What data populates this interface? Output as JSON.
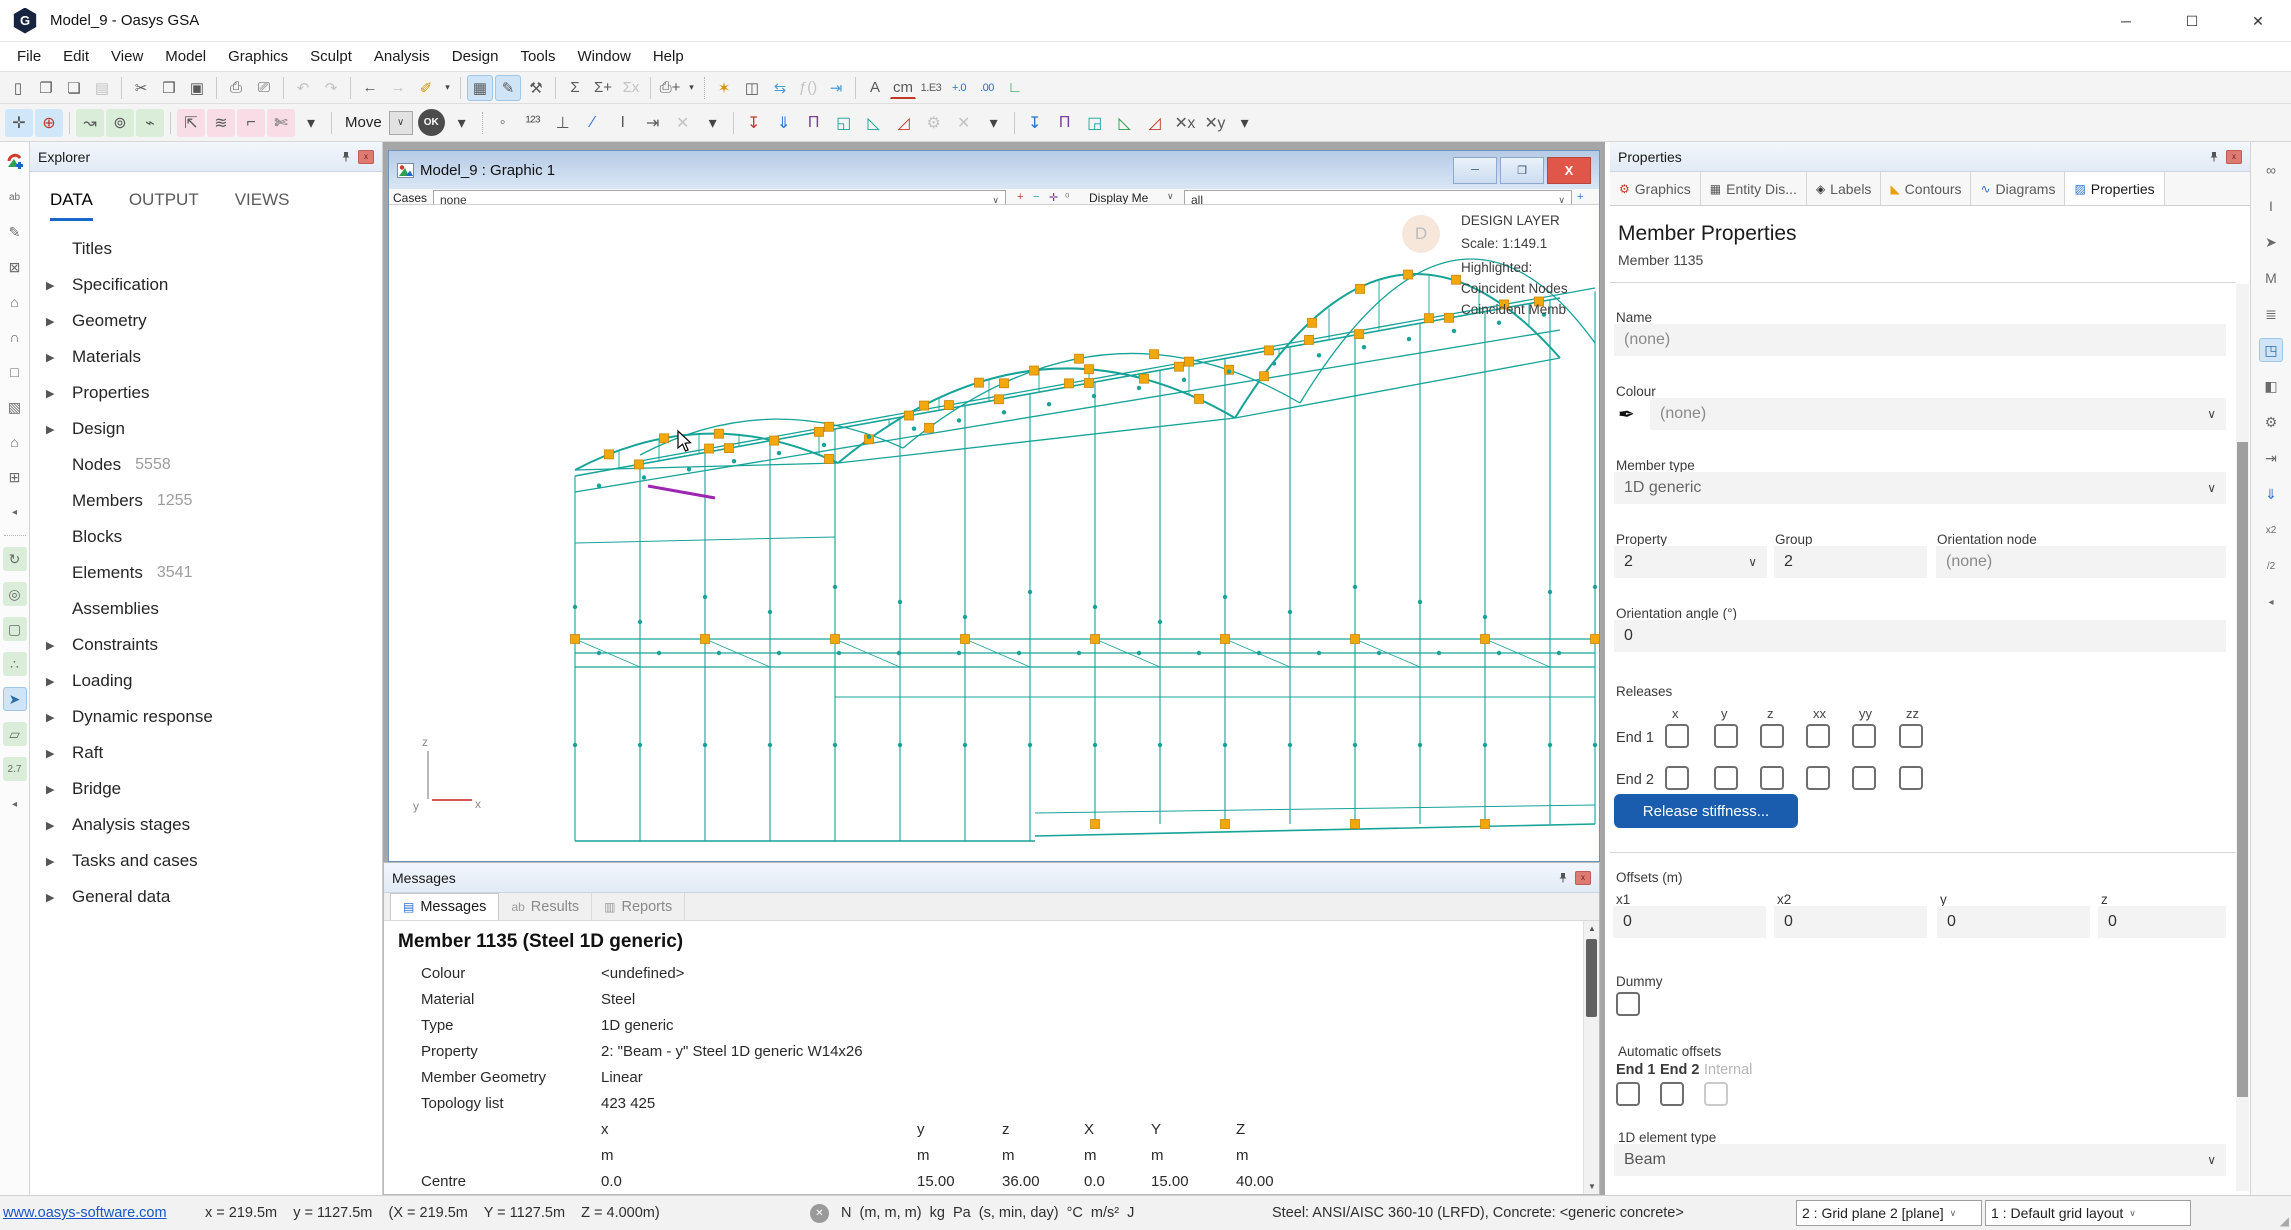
{
  "app": {
    "title": "Model_9 - Oasys GSA"
  },
  "menu": {
    "items": [
      "File",
      "Edit",
      "View",
      "Model",
      "Graphics",
      "Sculpt",
      "Analysis",
      "Design",
      "Tools",
      "Window",
      "Help"
    ]
  },
  "toolbar_labels": {
    "move": "Move",
    "ok": "OK"
  },
  "toolbar_main": [
    {
      "n": "new-file",
      "g": "▯"
    },
    {
      "n": "open-file",
      "g": "❐"
    },
    {
      "n": "open-recent",
      "g": "❏"
    },
    {
      "n": "save",
      "g": "▤",
      "d": 1
    },
    {
      "s": 1
    },
    {
      "n": "cut",
      "g": "✂"
    },
    {
      "n": "copy",
      "g": "❒"
    },
    {
      "n": "paste",
      "g": "▣"
    },
    {
      "s": 1
    },
    {
      "n": "print",
      "g": "⎙"
    },
    {
      "n": "print-preview",
      "g": "⎚"
    },
    {
      "s": 1
    },
    {
      "n": "undo",
      "g": "↶",
      "d": 1
    },
    {
      "n": "redo",
      "g": "↷",
      "d": 1
    },
    {
      "s": 1
    },
    {
      "n": "back",
      "g": "←"
    },
    {
      "n": "forward",
      "g": "→",
      "d": 1
    },
    {
      "n": "format-painter",
      "g": "✐",
      "c": "#d99000"
    },
    {
      "n": "format-painter-dropdown",
      "g": "▾",
      "dd": 1
    },
    {
      "s": 1
    },
    {
      "n": "table-view",
      "g": "▦",
      "a": 1
    },
    {
      "n": "sculpt-mode",
      "g": "✎",
      "a": 1
    },
    {
      "n": "tools-settings",
      "g": "⚒"
    },
    {
      "s": 1
    },
    {
      "n": "sum",
      "g": "Σ"
    },
    {
      "n": "sum-add",
      "g": "Σ+"
    },
    {
      "n": "sum-remove",
      "g": "Σx",
      "d": 1
    },
    {
      "s": 1
    },
    {
      "n": "print-view",
      "g": "⎙+"
    },
    {
      "n": "print-view-dropdown",
      "g": "▾",
      "dd": 1
    },
    {
      "ds": 1
    },
    {
      "n": "wizard",
      "g": "✶",
      "c": "#d99000"
    },
    {
      "n": "find",
      "g": "◫"
    },
    {
      "n": "sync-views",
      "g": "⇆",
      "c": "#4a9fd8"
    },
    {
      "n": "function",
      "g": "ƒ()",
      "d": 1
    },
    {
      "n": "wrap-lines",
      "g": "⇥",
      "c": "#4a9fd8"
    },
    {
      "s": 1
    },
    {
      "n": "font",
      "g": "A"
    },
    {
      "n": "units",
      "g": "cm",
      "u": 1
    },
    {
      "n": "numeric-format",
      "g": "1.E3",
      "sm": 1
    },
    {
      "n": "increase-decimals",
      "g": "+.0",
      "sm": 1,
      "c": "#2a6fd0"
    },
    {
      "n": "decrease-decimals",
      "g": ".00",
      "sm": 1,
      "c": "#2a6fd0"
    },
    {
      "n": "axes-display",
      "g": "∟",
      "c": "#2a9d4a"
    }
  ],
  "toolbar_sculpt": [
    {
      "n": "sculpt-drag",
      "g": "✛",
      "t": "blue"
    },
    {
      "n": "add-elements",
      "g": "⊕",
      "t": "blue",
      "c": "#c0392b"
    },
    {
      "s": 1
    },
    {
      "n": "modify-curve",
      "g": "↝",
      "t": "green"
    },
    {
      "n": "add-node",
      "g": "⊚",
      "t": "green"
    },
    {
      "n": "split-member",
      "g": "⌁",
      "t": "green"
    },
    {
      "s": 1
    },
    {
      "n": "move-axes",
      "g": "⇱",
      "t": "pink"
    },
    {
      "n": "flip-elements",
      "g": "≋",
      "t": "pink"
    },
    {
      "n": "offset-members",
      "g": "⌐",
      "t": "pink"
    },
    {
      "n": "trim-members",
      "g": "✄",
      "t": "pink"
    },
    {
      "n": "sculpt-dropdown",
      "g": "▾",
      "dd": 1
    },
    {
      "s": 1
    },
    {
      "type": "label",
      "n": "move-mode-label"
    },
    {
      "type": "sel",
      "n": "move-mode-select"
    },
    {
      "type": "ok",
      "n": "ok-button"
    },
    {
      "n": "ok-dropdown",
      "g": "▾",
      "dd": 1
    },
    {
      "ds": 1
    },
    {
      "n": "label-nodes",
      "g": "◦"
    },
    {
      "n": "label-node-numbers",
      "g": "¹²³",
      "sm": 1
    },
    {
      "n": "label-supports",
      "g": "⊥"
    },
    {
      "n": "label-member-numbers",
      "g": "∕",
      "c": "#2a6fd0"
    },
    {
      "n": "label-sections",
      "g": "I"
    },
    {
      "n": "label-align",
      "g": "⇥"
    },
    {
      "n": "labels-off",
      "g": "✕",
      "d": 1
    },
    {
      "n": "labels-dropdown",
      "g": "▾",
      "dd": 1
    },
    {
      "s": 1
    },
    {
      "n": "diagram-node-load",
      "g": "↧",
      "c": "#c0392b"
    },
    {
      "n": "diagram-beam-load",
      "g": "⇓",
      "c": "#2a6fd0"
    },
    {
      "n": "diagram-udl",
      "g": "Π",
      "c": "#7b3fa0"
    },
    {
      "n": "diagram-patch",
      "g": "◱",
      "c": "#17a398"
    },
    {
      "n": "diagram-shear",
      "g": "◺",
      "c": "#17a398"
    },
    {
      "n": "diagram-moment",
      "g": "◿",
      "c": "#c0392b"
    },
    {
      "n": "diagram-settings",
      "g": "⚙",
      "d": 1
    },
    {
      "n": "diagram-off",
      "g": "✕",
      "d": 1
    },
    {
      "n": "diagram-dropdown",
      "g": "▾",
      "dd": 1
    },
    {
      "s": 1
    },
    {
      "n": "contour-node-load",
      "g": "↧",
      "c": "#2a6fd0"
    },
    {
      "n": "contour-udl",
      "g": "Π",
      "c": "#7b3fa0"
    },
    {
      "n": "contour-patch",
      "g": "◲",
      "c": "#17a398"
    },
    {
      "n": "contour-shear",
      "g": "◺",
      "c": "#2a9d4a"
    },
    {
      "n": "contour-moment",
      "g": "◿",
      "c": "#c0392b"
    },
    {
      "n": "contour-x",
      "g": "✕x",
      "sm": 1
    },
    {
      "n": "contour-y",
      "g": "✕y",
      "sm": 1
    },
    {
      "n": "contour-dropdown",
      "g": "▾",
      "dd": 1
    }
  ],
  "left_strip": [
    {
      "n": "gsa-model",
      "logo": 1
    },
    {
      "n": "add-text",
      "g": "ab",
      "sm": 1
    },
    {
      "n": "sculpt-pencil",
      "g": "✎"
    },
    {
      "n": "section-view",
      "g": "⊠"
    },
    {
      "n": "structure-front",
      "g": "⌂"
    },
    {
      "n": "structure-side",
      "g": "∩"
    },
    {
      "n": "wireframe-box",
      "g": "□"
    },
    {
      "n": "solid-box",
      "g": "▧"
    },
    {
      "n": "building-view",
      "g": "⌂"
    },
    {
      "n": "expand-grid",
      "g": "⊞"
    },
    {
      "n": "collapse-left",
      "g": "◂",
      "sm": 1
    },
    {
      "ds": 1
    },
    {
      "n": "rotate-view",
      "g": "↻",
      "t": "green"
    },
    {
      "n": "zoom-view",
      "g": "◎",
      "t": "green"
    },
    {
      "n": "volume-view",
      "g": "▢",
      "t": "green"
    },
    {
      "n": "select-nodes",
      "g": "∴",
      "t": "green"
    },
    {
      "n": "select-members",
      "g": "➤",
      "a": 1
    },
    {
      "n": "polygon-select",
      "g": "▱",
      "t": "green"
    },
    {
      "n": "coordinate-entry",
      "g": "2.7",
      "t": "green",
      "sm": 1
    },
    {
      "n": "collapse-left-2",
      "g": "◂",
      "sm": 1
    }
  ],
  "right_strip": [
    {
      "n": "node-connection",
      "g": "∞"
    },
    {
      "n": "section-profile",
      "g": "I"
    },
    {
      "n": "pointer-settings",
      "g": "➤"
    },
    {
      "n": "polyline-tool",
      "g": "M"
    },
    {
      "n": "animation-strip",
      "g": "≣"
    },
    {
      "n": "volume-clip",
      "g": "◳",
      "a": 1
    },
    {
      "n": "contour-display-settings",
      "g": "◧"
    },
    {
      "n": "graphic-settings",
      "g": "⚙"
    },
    {
      "n": "shrink-elements",
      "g": "⇥"
    },
    {
      "n": "diagram-scale",
      "g": "⇓",
      "c": "#2a6fd0"
    },
    {
      "n": "scale-x2",
      "g": "x2",
      "sm": 1
    },
    {
      "n": "scale-half",
      "g": "/2",
      "sm": 1
    },
    {
      "n": "collapse-right",
      "g": "◂",
      "sm": 1
    }
  ],
  "explorer": {
    "title": "Explorer",
    "tabs": [
      {
        "label": "DATA",
        "active": true
      },
      {
        "label": "OUTPUT",
        "active": false
      },
      {
        "label": "VIEWS",
        "active": false
      }
    ],
    "tree": [
      {
        "label": "Titles"
      },
      {
        "label": "Specification",
        "expandable": true
      },
      {
        "label": "Geometry",
        "expandable": true
      },
      {
        "label": "Materials",
        "expandable": true
      },
      {
        "label": "Properties",
        "expandable": true
      },
      {
        "label": "Design",
        "expandable": true
      },
      {
        "label": "Nodes",
        "count": "5558"
      },
      {
        "label": "Members",
        "count": "1255"
      },
      {
        "label": "Blocks"
      },
      {
        "label": "Elements",
        "count": "3541"
      },
      {
        "label": "Assemblies"
      },
      {
        "label": "Constraints",
        "expandable": true
      },
      {
        "label": "Loading",
        "expandable": true
      },
      {
        "label": "Dynamic response",
        "expandable": true
      },
      {
        "label": "Raft",
        "expandable": true
      },
      {
        "label": "Bridge",
        "expandable": true
      },
      {
        "label": "Analysis stages",
        "expandable": true
      },
      {
        "label": "Tasks and cases",
        "expandable": true
      },
      {
        "label": "General data",
        "expandable": true
      }
    ]
  },
  "graphic": {
    "title": "Model_9 : Graphic 1",
    "toolbar": {
      "cases_label": "Cases",
      "cases_value": "none",
      "display_label": "Display Me",
      "display_value": "all"
    },
    "overlay": {
      "badge": "D",
      "layer": "DESIGN LAYER",
      "scale": "Scale: 1:149.1",
      "highlighted": "Highlighted:",
      "line1": "Coincident Nodes",
      "line2": "Coincident Memb"
    },
    "axes": {
      "z": "z",
      "y": "y",
      "x": "x"
    }
  },
  "messages": {
    "title": "Messages",
    "tabs": [
      {
        "label": "Messages",
        "icon": "▤",
        "icon_name": "list-icon",
        "active": true
      },
      {
        "label": "Results",
        "icon": "ab",
        "icon_name": "text-result-icon",
        "active": false
      },
      {
        "label": "Reports",
        "icon": "▥",
        "icon_name": "report-icon",
        "active": false
      }
    ],
    "heading": "Member 1135 (Steel 1D generic)",
    "rows": [
      [
        "Colour",
        "<undefined>"
      ],
      [
        "Material",
        "Steel"
      ],
      [
        "Type",
        "1D generic"
      ],
      [
        "Property",
        "2: \"Beam - y\" Steel 1D generic W14x26"
      ],
      [
        "Member Geometry",
        "Linear"
      ],
      [
        "Topology list",
        "423 425"
      ]
    ],
    "table": {
      "headers": [
        "x",
        "y",
        "z",
        "X",
        "Y",
        "Z"
      ],
      "units": [
        "m",
        "m",
        "m",
        "m",
        "m",
        "m"
      ],
      "row_label": "Centre",
      "values": [
        "0.0",
        "15.00",
        "36.00",
        "0.0",
        "15.00",
        "40.00"
      ]
    }
  },
  "properties": {
    "title": "Properties",
    "tabs": [
      {
        "label": "Graphics",
        "icon": "⚙",
        "color": "#c0392b",
        "active": false
      },
      {
        "label": "Entity Dis...",
        "icon": "▦",
        "color": "#555555",
        "active": false
      },
      {
        "label": "Labels",
        "icon": "◈",
        "color": "#333333",
        "active": false
      },
      {
        "label": "Contours",
        "icon": "◣",
        "color": "#e8a000",
        "active": false
      },
      {
        "label": "Diagrams",
        "icon": "∿",
        "color": "#2a6fd0",
        "active": false
      },
      {
        "label": "Properties",
        "icon": "▨",
        "color": "#2a6fd0",
        "active": true
      }
    ],
    "heading": "Member Properties",
    "subheading": "Member 1135",
    "name_label": "Name",
    "name_value": "(none)",
    "colour_label": "Colour",
    "colour_value": "(none)",
    "member_type_label": "Member type",
    "member_type_value": "1D generic",
    "property_label": "Property",
    "property_value": "2",
    "group_label": "Group",
    "group_value": "2",
    "orientation_node_label": "Orientation node",
    "orientation_node_value": "(none)",
    "orientation_angle_label": "Orientation angle (°)",
    "orientation_angle_value": "0",
    "releases_label": "Releases",
    "release_cols": [
      "x",
      "y",
      "z",
      "xx",
      "yy",
      "zz"
    ],
    "release_rows": [
      "End 1",
      "End 2"
    ],
    "release_stiffness": "Release stiffness...",
    "offsets_label": "Offsets (m)",
    "offsets": [
      {
        "label": "x1",
        "value": "0"
      },
      {
        "label": "x2",
        "value": "0"
      },
      {
        "label": "y",
        "value": "0"
      },
      {
        "label": "z",
        "value": "0"
      }
    ],
    "dummy_label": "Dummy",
    "auto_offsets_label": "Automatic offsets",
    "auto_offsets": [
      {
        "label": "End 1",
        "disabled": false
      },
      {
        "label": "End 2",
        "disabled": false
      },
      {
        "label": "Internal",
        "disabled": true
      }
    ],
    "element_type_label": "1D element type",
    "element_type_value": "Beam"
  },
  "status": {
    "link": "www.oasys-software.com",
    "coords": "x = 219.5m    y = 1127.5m    (X = 219.5m    Y = 1127.5m    Z = 4.000m)",
    "units": "N  (m, m, m)  kg  Pa  (s, min, day)  °C  m/s²  J",
    "codes": "Steel: ANSI/AISC 360-10 (LRFD), Concrete: <gener­ic concrete>",
    "grid_plane": "2 : Grid plane 2 [plane]",
    "grid_layout": "1 : Default grid layout"
  },
  "colors": {
    "accent_blue": "#1b66c9",
    "model_teal": "#17a398",
    "node_yellow": "#f2a70a",
    "selection_purple": "#9c27b0",
    "button_blue": "#1a5dae",
    "close_red": "#e0574a"
  }
}
